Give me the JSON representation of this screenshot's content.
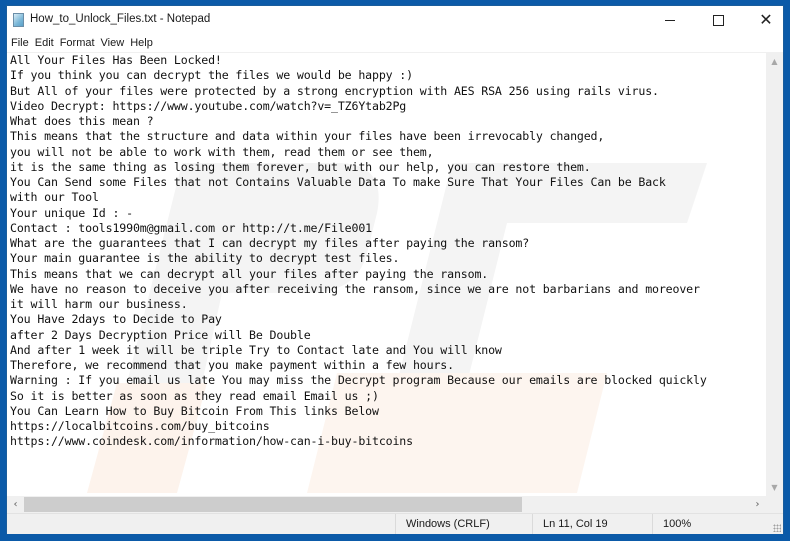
{
  "window": {
    "title": "How_to_Unlock_Files.txt - Notepad",
    "app_icon": "notepad-icon",
    "controls": {
      "minimize": "minimize-icon",
      "maximize": "maximize-icon",
      "close": "close-icon",
      "close_glyph": "✕"
    }
  },
  "menu": {
    "items": [
      {
        "label": "File"
      },
      {
        "label": "Edit"
      },
      {
        "label": "Format"
      },
      {
        "label": "View"
      },
      {
        "label": "Help"
      }
    ]
  },
  "document": {
    "lines": [
      "All Your Files Has Been Locked!",
      "If you think you can decrypt the files we would be happy :)",
      "But All of your files were protected by a strong encryption with AES RSA 256 using rails virus.",
      "Video Decrypt: https://www.youtube.com/watch?v=_TZ6Ytab2Pg",
      "What does this mean ?",
      "This means that the structure and data within your files have been irrevocably changed,",
      "you will not be able to work with them, read them or see them,",
      "it is the same thing as losing them forever, but with our help, you can restore them.",
      "You Can Send some Files that not Contains Valuable Data To make Sure That Your Files Can be Back",
      "with our Tool",
      "Your unique Id : -",
      "Contact : tools1990m@gmail.com or http://t.me/File001",
      "What are the guarantees that I can decrypt my files after paying the ransom?",
      "Your main guarantee is the ability to decrypt test files.",
      "This means that we can decrypt all your files after paying the ransom.",
      "We have no reason to deceive you after receiving the ransom, since we are not barbarians and moreover",
      "it will harm our business.",
      "You Have 2days to Decide to Pay",
      "after 2 Days Decryption Price will Be Double",
      "And after 1 week it will be triple Try to Contact late and You will know",
      "Therefore, we recommend that you make payment within a few hours.",
      "Warning : If you email us late You may miss the Decrypt program Because our emails are blocked quickly",
      "So it is better as soon as they read email Email us ;)",
      "You Can Learn How to Buy Bitcoin From This links Below",
      "https://localbitcoins.com/buy_bitcoins",
      "https://www.coindesk.com/information/how-can-i-buy-bitcoins"
    ]
  },
  "scrollbars": {
    "vertical": {
      "up": "▲",
      "down": "▼"
    },
    "horizontal": {
      "left": "‹",
      "right": "›"
    }
  },
  "statusbar": {
    "line_ending": "Windows (CRLF)",
    "position": "Ln 11, Col 19",
    "zoom": "100%"
  },
  "colors": {
    "desktop": "#0b5aa8",
    "watermark_gray": "#f2f2f2",
    "watermark_orange": "#fdf1e8"
  }
}
